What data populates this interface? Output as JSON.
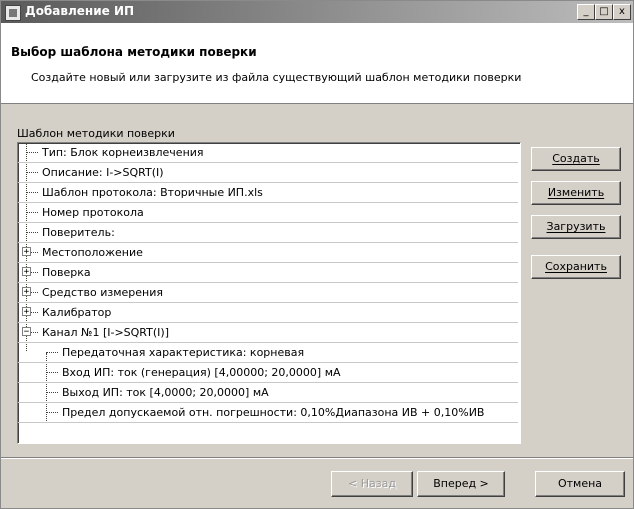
{
  "window": {
    "title": "Добавление ИП",
    "controls": {
      "minimize": "_",
      "maximize": "□",
      "close": "x"
    }
  },
  "header": {
    "title": "Выбор шаблона методики поверки",
    "subtitle": "Создайте новый или загрузите из файла существующий шаблон методики поверки"
  },
  "template_group": {
    "label": "Шаблон методики поверки",
    "items": [
      "Тип: Блок корнеизвлечения",
      "Описание: I->SQRT(I)",
      "Шаблон протокола: Вторичные ИП.xls",
      "Номер протокола",
      "Поверитель:",
      "Местоположение",
      "Поверка",
      "Средство измерения",
      "Калибратор",
      "Канал №1 [I->SQRT(I)]",
      "Передаточная характеристика: корневая",
      "Вход ИП: ток (генерация) [4,00000; 20,0000] мА",
      "Выход ИП: ток [4,0000; 20,0000] мА",
      "Предел допускаемой отн. погрешности: 0,10%Диапазона ИВ + 0,10%ИВ"
    ]
  },
  "side_buttons": {
    "create": "Создать",
    "edit": "Изменить",
    "load": "Загрузить",
    "save": "Сохранить"
  },
  "footer": {
    "back": "< Назад",
    "next": "Вперед >",
    "cancel": "Отмена"
  },
  "colors": {
    "dialog_bg": "#d4d0c8",
    "titlebar_start": "#5a5a5a",
    "titlebar_end": "#bdbdbd",
    "header_bg": "#ffffff"
  }
}
